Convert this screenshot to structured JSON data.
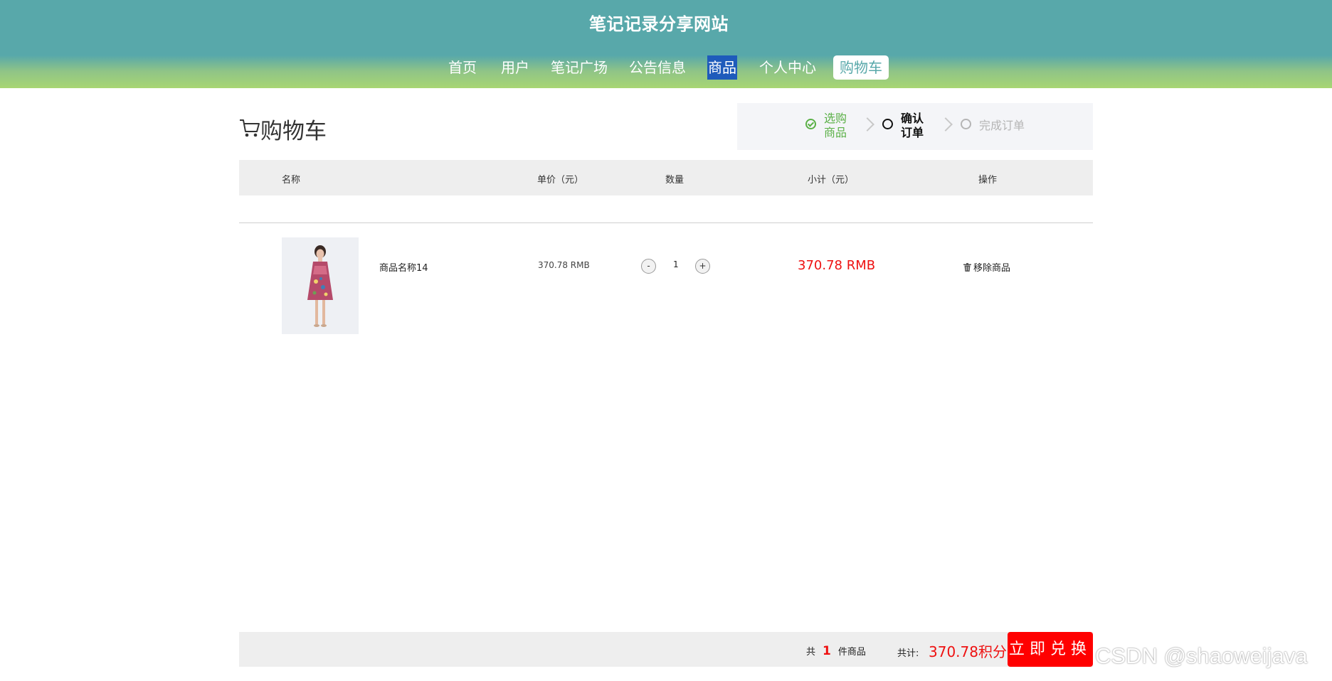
{
  "header": {
    "site_title": "笔记记录分享网站",
    "nav": [
      "首页",
      "用户",
      "笔记广场",
      "公告信息",
      "商品",
      "个人中心",
      "购物车"
    ]
  },
  "page": {
    "title": "购物车",
    "steps": [
      "选购\n商品",
      "确认\n订单",
      "完成订单"
    ]
  },
  "table": {
    "headers": [
      "名称",
      "单价（元）",
      "数量",
      "小计（元）",
      "操作"
    ],
    "rows": [
      {
        "name": "商品名称14",
        "unit_price": "370.78 RMB",
        "qty_minus": "-",
        "quantity": "1",
        "qty_plus": "+",
        "subtotal": "370.78 RMB",
        "action": "移除商品"
      }
    ]
  },
  "footer": {
    "count_prefix": "共",
    "count": "1",
    "count_suffix": "件商品",
    "total_label": "共计:",
    "total": "370.78积分",
    "buy_button": "立即兑换"
  },
  "watermark": "CSDN @shaoweijava",
  "colors": {
    "header": "#58a8aa",
    "accent_red": "#ee1111",
    "nav_active": "#1e5bbb",
    "step_done": "#5ab046"
  }
}
